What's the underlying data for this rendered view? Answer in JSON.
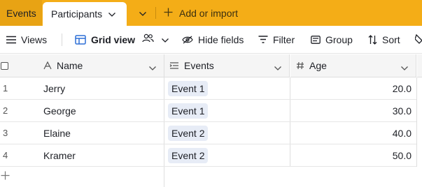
{
  "tabs": {
    "events_label": "Events",
    "participants_label": "Participants",
    "add_label": "Add or import"
  },
  "toolbar": {
    "views_label": "Views",
    "grid_view_label": "Grid view",
    "hide_fields_label": "Hide fields",
    "filter_label": "Filter",
    "group_label": "Group",
    "sort_label": "Sort"
  },
  "columns": {
    "name": "Name",
    "events": "Events",
    "age": "Age"
  },
  "rows": [
    {
      "num": "1",
      "name": "Jerry",
      "event": "Event 1",
      "age": "20.0"
    },
    {
      "num": "2",
      "name": "George",
      "event": "Event 1",
      "age": "30.0"
    },
    {
      "num": "3",
      "name": "Elaine",
      "event": "Event 2",
      "age": "40.0"
    },
    {
      "num": "4",
      "name": "Kramer",
      "event": "Event 2",
      "age": "50.0"
    }
  ],
  "colors": {
    "tabbar": "#f4ad17",
    "pill": "#e7ecf6",
    "header_bg": "#f5f5f5"
  },
  "icons": [
    "chevron-down-icon",
    "plus-icon",
    "hamburger-icon",
    "grid-icon",
    "people-icon",
    "eye-off-icon",
    "filter-icon",
    "group-icon",
    "sort-icon",
    "paint-icon",
    "text-field-icon",
    "link-field-icon",
    "number-field-icon"
  ]
}
